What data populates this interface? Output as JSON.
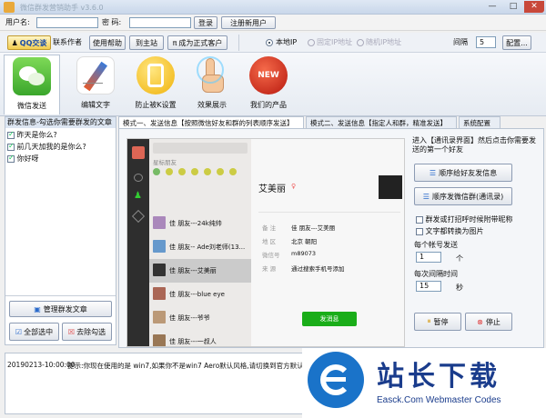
{
  "window": {
    "title": "微信群发营销助手 v3.6.0",
    "minimize": "—",
    "maximize": "□",
    "close": "✕"
  },
  "login": {
    "user_label": "用户名:",
    "user_value": "",
    "pass_label": "密  码:",
    "pass_value": "",
    "login_btn": "登录",
    "register_btn": "注册新用户"
  },
  "toolbar": {
    "qq_btn": "QQ交谈",
    "contact_author": "联系作者",
    "help": "使用帮助",
    "goto_site": "到主站",
    "become_customer": "成为正式客户",
    "local_ip_label": "本地IP",
    "opt2": "固定IP地址",
    "opt3": "随机IP地址",
    "interval_label": "间隔",
    "interval_value": "5",
    "config_btn": "配置..."
  },
  "features": [
    {
      "label": "微信发送",
      "icon": "wechat-icon"
    },
    {
      "label": "编辑文字",
      "icon": "edit-icon"
    },
    {
      "label": "防止被K设置",
      "icon": "shield-icon"
    },
    {
      "label": "效果展示",
      "icon": "hand-icon"
    },
    {
      "label": "我们的产品",
      "icon": "new-badge-icon"
    }
  ],
  "left_panel": {
    "header": "群发信息-勾选你需要群发的文章",
    "items": [
      {
        "label": "昨天是你么?",
        "checked": true
      },
      {
        "label": "前几天加我的是你么?",
        "checked": true
      },
      {
        "label": "你好呀",
        "checked": true
      }
    ],
    "manage_btn": "管理群发文章",
    "select_all_btn": "全部选中",
    "deselect_btn": "去除勾选"
  },
  "tabs": [
    {
      "label": "模式一、发送信息【按照微信好友和群的列表顺序发送】",
      "active": true
    },
    {
      "label": "模式二、发送信息【指定人和群，精准发送】",
      "active": false
    },
    {
      "label": "系统配置",
      "active": false
    }
  ],
  "wechat": {
    "list": [
      {
        "name": "星标朋友"
      },
      {
        "name": "佳 朋友---24k纯帅"
      },
      {
        "name": "佳 朋友-- Ade刘老师(13..."
      },
      {
        "name": "佳 朋友---艾美丽"
      },
      {
        "name": "佳 朋友---blue eye"
      },
      {
        "name": "佳 朋友---爷爷"
      },
      {
        "name": "佳 朋友---一叔人"
      }
    ],
    "contact_name": "艾美丽",
    "fields": [
      {
        "k": "备    注",
        "v": "佳 朋友---艾美丽"
      },
      {
        "k": "地    区",
        "v": "北京 朝阳"
      },
      {
        "k": "微信号",
        "v": "m89073"
      },
      {
        "k": "来    源",
        "v": "通过搜索手机号添加"
      }
    ],
    "send_btn": "发消息"
  },
  "right_panel": {
    "hint": "进入【通讯录界面】然后点击你需要发送的第一个好友",
    "btn_friends": "顺序给好友发信息",
    "btn_groups": "顺序发微信群(通讯录)",
    "opt1": "群发或打招呼时候附带昵称",
    "opt2": "文字都转换为图片",
    "count_label": "每个帐号发送",
    "count_value": "1",
    "count_unit": "个",
    "interval_label": "每次间隔时间",
    "interval_value": "15",
    "interval_unit": "秒",
    "pause_btn": "暂停",
    "stop_btn": "停止"
  },
  "log": {
    "timestamp": "20190213-10:00:00",
    "message": "提示:你现在使用的是 win7,如果你不是win7 Aero默认风格,请切换到官方默认"
  },
  "watermark": {
    "title": "站长下载",
    "subtitle": "Easck.Com Webmaster Codes"
  }
}
